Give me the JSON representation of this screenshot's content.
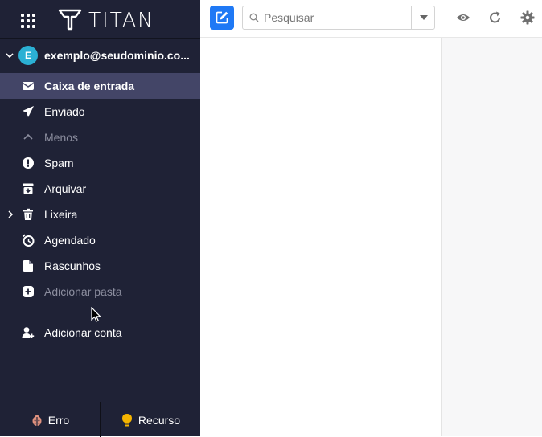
{
  "brand": {
    "name": "TITAN"
  },
  "account": {
    "initial": "E",
    "email": "exemplo@seudominio.co..."
  },
  "folders": [
    {
      "label": "Caixa de entrada",
      "icon": "envelope-icon"
    },
    {
      "label": "Enviado",
      "icon": "paper-plane-icon"
    },
    {
      "label": "Menos",
      "icon": "chevron-up-icon"
    },
    {
      "label": "Spam",
      "icon": "exclamation-circle-icon"
    },
    {
      "label": "Arquivar",
      "icon": "archive-icon"
    },
    {
      "label": "Lixeira",
      "icon": "trash-icon"
    },
    {
      "label": "Agendado",
      "icon": "clock-icon"
    },
    {
      "label": "Rascunhos",
      "icon": "draft-icon"
    },
    {
      "label": "Adicionar pasta",
      "icon": "plus-circle-icon"
    }
  ],
  "add_account": {
    "label": "Adicionar conta"
  },
  "footer": {
    "error_label": "Erro",
    "feature_label": "Recurso"
  },
  "search": {
    "placeholder": "Pesquisar"
  },
  "colors": {
    "sidebar": "#1f2236",
    "active": "#434567",
    "accent": "#1f79f5",
    "avatar": "#2bb0d4"
  }
}
